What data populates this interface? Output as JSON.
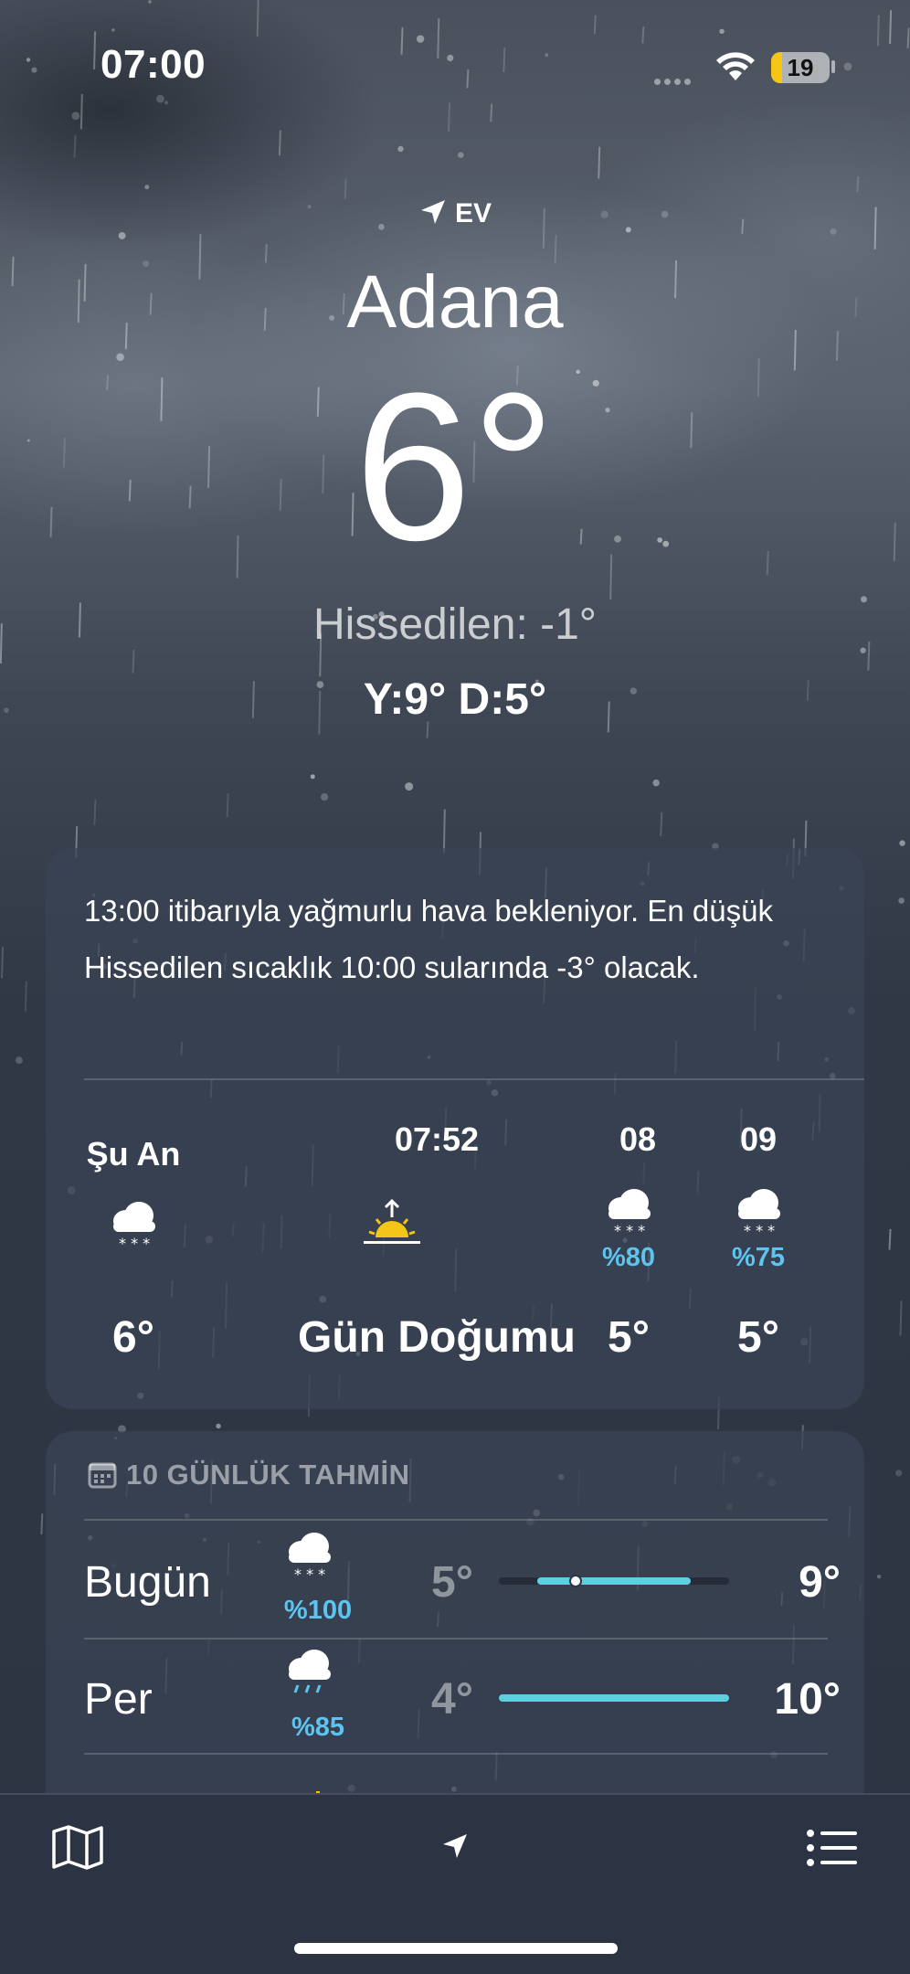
{
  "status_bar": {
    "time": "07:00",
    "battery": "19",
    "battery_color": "#f5c518"
  },
  "location": {
    "label": "EV",
    "city": "Adana",
    "temperature": "6°",
    "feels_like": "Hissedilen: -1°",
    "high_low": "Y:9° D:5°"
  },
  "hourly": {
    "summary": "13:00 itibarıyla yağmurlu hava bekleniyor. En düşük Hissedilen sıcaklık 10:00 sularında -3° olacak.",
    "items": [
      {
        "label": "Şu An",
        "icon": "snow-cloud-icon",
        "precip": "",
        "temp": "6°"
      },
      {
        "label": "07:52",
        "icon": "sunrise-icon",
        "precip": "",
        "temp": "Gün Doğumu"
      },
      {
        "label": "08",
        "icon": "snow-cloud-icon",
        "precip": "%80",
        "temp": "5°"
      },
      {
        "label": "09",
        "icon": "snow-cloud-icon",
        "precip": "%75",
        "temp": "5°"
      }
    ],
    "precip_color": "#5ec4ef"
  },
  "daily": {
    "header": "10 GÜNLÜK TAHMİN",
    "week_low": 4,
    "week_high": 10,
    "days": [
      {
        "name": "Bugün",
        "icon": "snow-cloud-icon",
        "precip": "%100",
        "low": "5°",
        "high": "9°",
        "low_value": 5,
        "high_value": 9,
        "current": 6
      },
      {
        "name": "Per",
        "icon": "rain-cloud-icon",
        "precip": "%85",
        "low": "4°",
        "high": "10°",
        "low_value": 4,
        "high_value": 10
      }
    ]
  },
  "tabbar": {
    "map": "map-icon",
    "location": "location-arrow-icon",
    "list": "list-icon"
  }
}
